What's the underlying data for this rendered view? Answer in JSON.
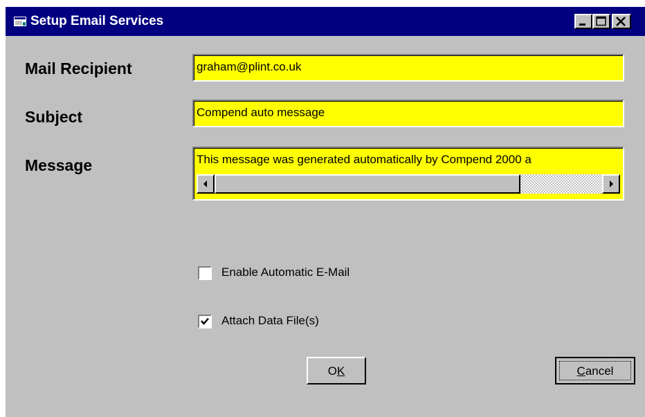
{
  "window": {
    "title": "Setup Email Services",
    "controls": {
      "minimize": "minimize-icon",
      "maximize": "maximize-icon",
      "close": "close-icon"
    }
  },
  "form": {
    "recipient": {
      "label": "Mail Recipient",
      "value": "graham@plint.co.uk"
    },
    "subject": {
      "label": "Subject",
      "value": "Compend auto message"
    },
    "message": {
      "label": "Message",
      "value": "This message was generated automatically by Compend 2000 a"
    }
  },
  "options": {
    "enable_auto": {
      "label": "Enable Automatic E-Mail",
      "checked": false
    },
    "attach_files": {
      "label": "Attach Data File(s)",
      "checked": true
    }
  },
  "buttons": {
    "ok": {
      "label_prefix": "O",
      "accel": "K",
      "label_suffix": ""
    },
    "cancel": {
      "label_prefix": "",
      "accel": "C",
      "label_suffix": "ancel"
    }
  },
  "colors": {
    "titlebar": "#000080",
    "field_bg": "#ffff00",
    "face": "#c0c0c0"
  }
}
